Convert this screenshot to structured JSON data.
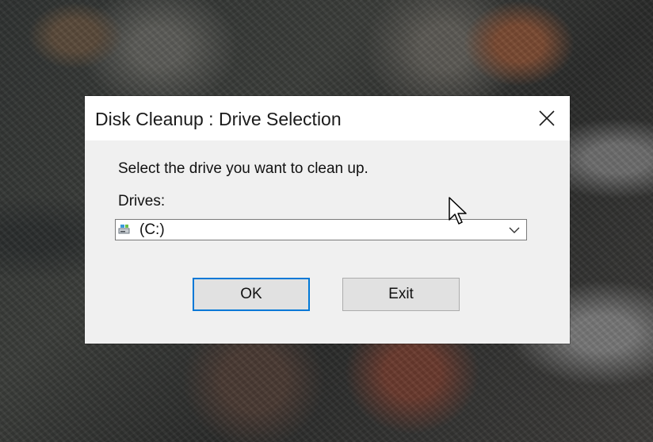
{
  "dialog": {
    "title": "Disk Cleanup : Drive Selection",
    "prompt": "Select the drive you want to clean up.",
    "drives_label": "Drives:",
    "selected_drive": "(C:)",
    "ok_label": "OK",
    "exit_label": "Exit"
  },
  "icons": {
    "close": "close-icon",
    "drive": "hard-drive-icon",
    "dropdown": "chevron-down-icon",
    "cursor": "mouse-pointer-icon"
  },
  "colors": {
    "accent": "#0078d7",
    "dialog_bg": "#f0f0f0",
    "titlebar_bg": "#ffffff",
    "button_bg": "#e1e1e1"
  }
}
